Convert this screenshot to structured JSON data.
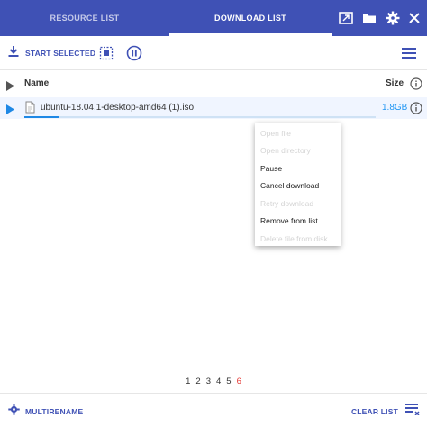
{
  "header": {
    "tabs": [
      {
        "label": "RESOURCE LIST",
        "active": false
      },
      {
        "label": "DOWNLOAD LIST",
        "active": true
      }
    ],
    "icons": [
      "picture-in-picture-icon",
      "folder-icon",
      "gear-icon",
      "close-icon"
    ]
  },
  "toolbar": {
    "start_selected_label": "START SELECTED",
    "icons": [
      "download-icon",
      "select-all-icon",
      "pause-circle-icon",
      "menu-icon"
    ]
  },
  "table": {
    "columns": {
      "name": "Name",
      "size": "Size"
    },
    "rows": [
      {
        "name": "ubuntu-18.04.1-desktop-amd64 (1).iso",
        "size": "1.8GB",
        "progress_percent": 10
      }
    ]
  },
  "context_menu": {
    "items": [
      {
        "label": "Open file",
        "enabled": false
      },
      {
        "label": "Open directory",
        "enabled": false
      },
      {
        "label": "Pause",
        "enabled": true
      },
      {
        "label": "Cancel download",
        "enabled": true
      },
      {
        "label": "Retry download",
        "enabled": false
      },
      {
        "label": "Remove from list",
        "enabled": true
      },
      {
        "label": "Delete file from disk",
        "enabled": false
      }
    ]
  },
  "pagination": {
    "pages": [
      "1",
      "2",
      "3",
      "4",
      "5",
      "6"
    ],
    "current": "6"
  },
  "footer": {
    "multirename_label": "MULTIRENAME",
    "clear_list_label": "CLEAR LIST"
  },
  "colors": {
    "primary": "#3f51b5",
    "accent_blue": "#2196f3",
    "current_page": "#e53935"
  }
}
